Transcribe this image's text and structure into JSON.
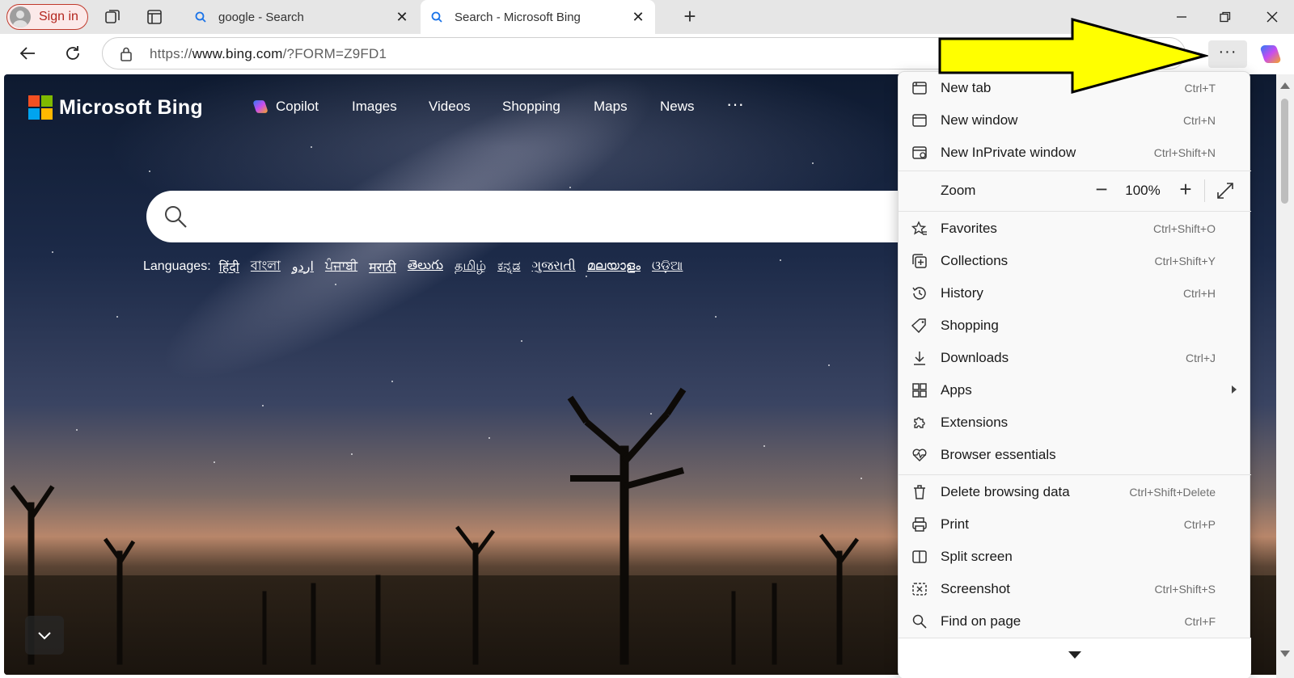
{
  "tabstrip": {
    "signin_label": "Sign in",
    "tabs": [
      {
        "title": "google - Search",
        "active": false
      },
      {
        "title": "Search - Microsoft Bing",
        "active": true
      }
    ]
  },
  "addressbar": {
    "url_prefix": "https://",
    "url_host": "www.bing.com",
    "url_path": "/?FORM=Z9FD1"
  },
  "page": {
    "brand": "Microsoft Bing",
    "nav": [
      "Copilot",
      "Images",
      "Videos",
      "Shopping",
      "Maps",
      "News",
      "···"
    ],
    "languages_label": "Languages:",
    "languages": [
      "हिंदी",
      "বাংলা",
      "اردو",
      "ਪੰਜਾਬੀ",
      "मराठी",
      "తెలుగు",
      "தமிழ்",
      "ಕನ್ನಡ",
      "ગુજરાતી",
      "മലയാളം",
      "ଓଡ଼ିଆ"
    ]
  },
  "menu": {
    "items": [
      {
        "label": "New tab",
        "shortcut": "Ctrl+T",
        "icon": "new-tab-icon"
      },
      {
        "label": "New window",
        "shortcut": "Ctrl+N",
        "icon": "new-window-icon"
      },
      {
        "label": "New InPrivate window",
        "shortcut": "Ctrl+Shift+N",
        "icon": "inprivate-icon"
      },
      {
        "label": "Favorites",
        "shortcut": "Ctrl+Shift+O",
        "icon": "favorites-icon"
      },
      {
        "label": "Collections",
        "shortcut": "Ctrl+Shift+Y",
        "icon": "collections-icon"
      },
      {
        "label": "History",
        "shortcut": "Ctrl+H",
        "icon": "history-icon"
      },
      {
        "label": "Shopping",
        "shortcut": "",
        "icon": "shopping-tag-icon"
      },
      {
        "label": "Downloads",
        "shortcut": "Ctrl+J",
        "icon": "download-icon"
      },
      {
        "label": "Apps",
        "shortcut": "",
        "icon": "apps-icon"
      },
      {
        "label": "Extensions",
        "shortcut": "",
        "icon": "puzzle-icon"
      },
      {
        "label": "Browser essentials",
        "shortcut": "",
        "icon": "heart-pulse-icon"
      },
      {
        "label": "Delete browsing data",
        "shortcut": "Ctrl+Shift+Delete",
        "icon": "trash-icon"
      },
      {
        "label": "Print",
        "shortcut": "Ctrl+P",
        "icon": "printer-icon"
      },
      {
        "label": "Split screen",
        "shortcut": "",
        "icon": "split-screen-icon"
      },
      {
        "label": "Screenshot",
        "shortcut": "Ctrl+Shift+S",
        "icon": "screenshot-icon"
      },
      {
        "label": "Find on page",
        "shortcut": "Ctrl+F",
        "icon": "find-icon"
      }
    ],
    "zoom_label": "Zoom",
    "zoom_value": "100%",
    "zoom_minus": "−",
    "zoom_plus": "+"
  },
  "colors": {
    "annotation_arrow": "#ffff00",
    "ms_red": "#f25022",
    "ms_green": "#7fba00",
    "ms_blue": "#00a4ef",
    "ms_yellow": "#ffb900"
  }
}
